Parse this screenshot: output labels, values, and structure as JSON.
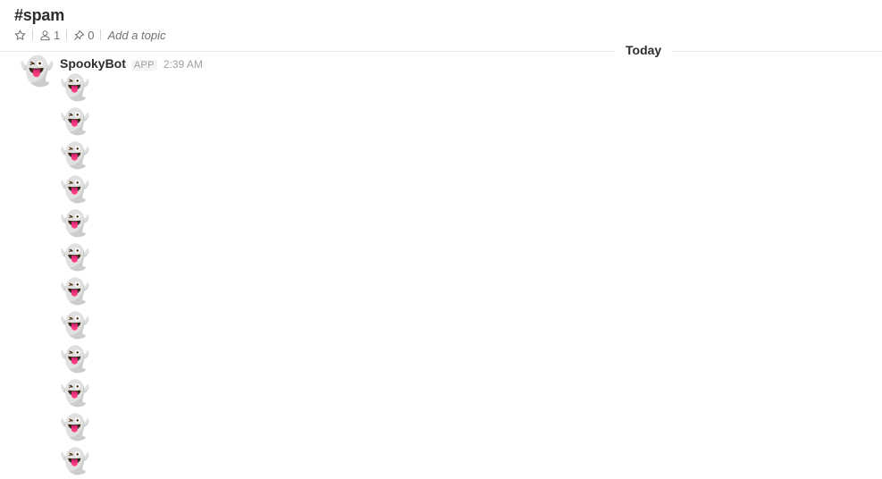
{
  "channel": {
    "name": "#spam",
    "members_count": "1",
    "pinned_count": "0",
    "topic_placeholder": "Add a topic",
    "icons": {
      "star": "star-icon",
      "members": "person-icon",
      "pins": "pin-icon"
    }
  },
  "divider": {
    "label": "Today"
  },
  "message": {
    "sender": "SpookyBot",
    "badge": "APP",
    "timestamp": "2:39 AM",
    "avatar_emoji": "👻",
    "lines": [
      "👻",
      "👻",
      "👻",
      "👻",
      "👻",
      "👻",
      "👻",
      "👻",
      "👻",
      "👻",
      "👻",
      "👻"
    ]
  }
}
